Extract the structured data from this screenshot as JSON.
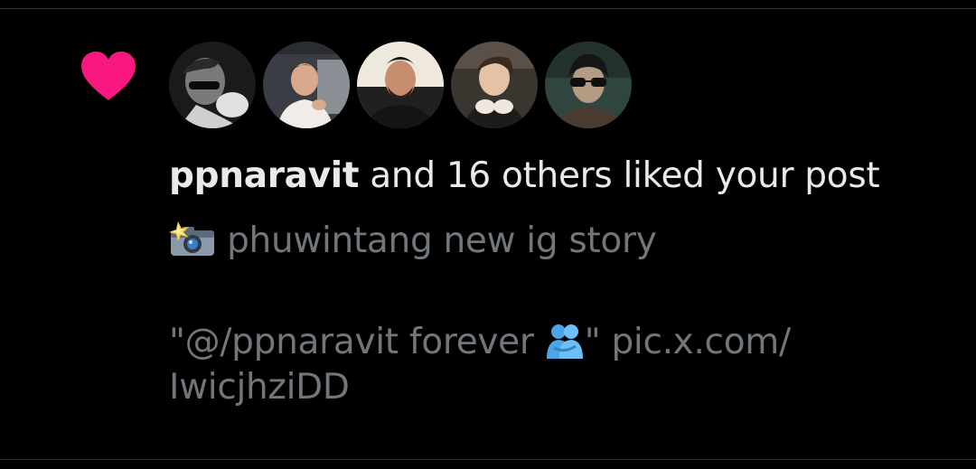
{
  "notification": {
    "username": "ppnaravit",
    "action_text": " and 16 others liked your post",
    "heart_color": "#f91880",
    "avatar_count_shown": 5,
    "avatars": [
      {
        "icon": "avatar-1-photo"
      },
      {
        "icon": "avatar-2-photo"
      },
      {
        "icon": "avatar-3-photo"
      },
      {
        "icon": "avatar-4-photo"
      },
      {
        "icon": "avatar-5-photo"
      }
    ]
  },
  "post_preview": {
    "line1_emoji": "camera-flash-emoji",
    "line1_text": " phuwintang new ig story",
    "line2_prefix": "\"@/ppnaravit forever ",
    "line2_emoji": "people-hugging-emoji",
    "line2_suffix": "\" pic.x.com/",
    "line3_text": "IwicjhziDD"
  },
  "colors": {
    "background": "#000000",
    "primary_text": "#e7e9ea",
    "secondary_text": "#71767b",
    "divider": "#2f3336"
  }
}
